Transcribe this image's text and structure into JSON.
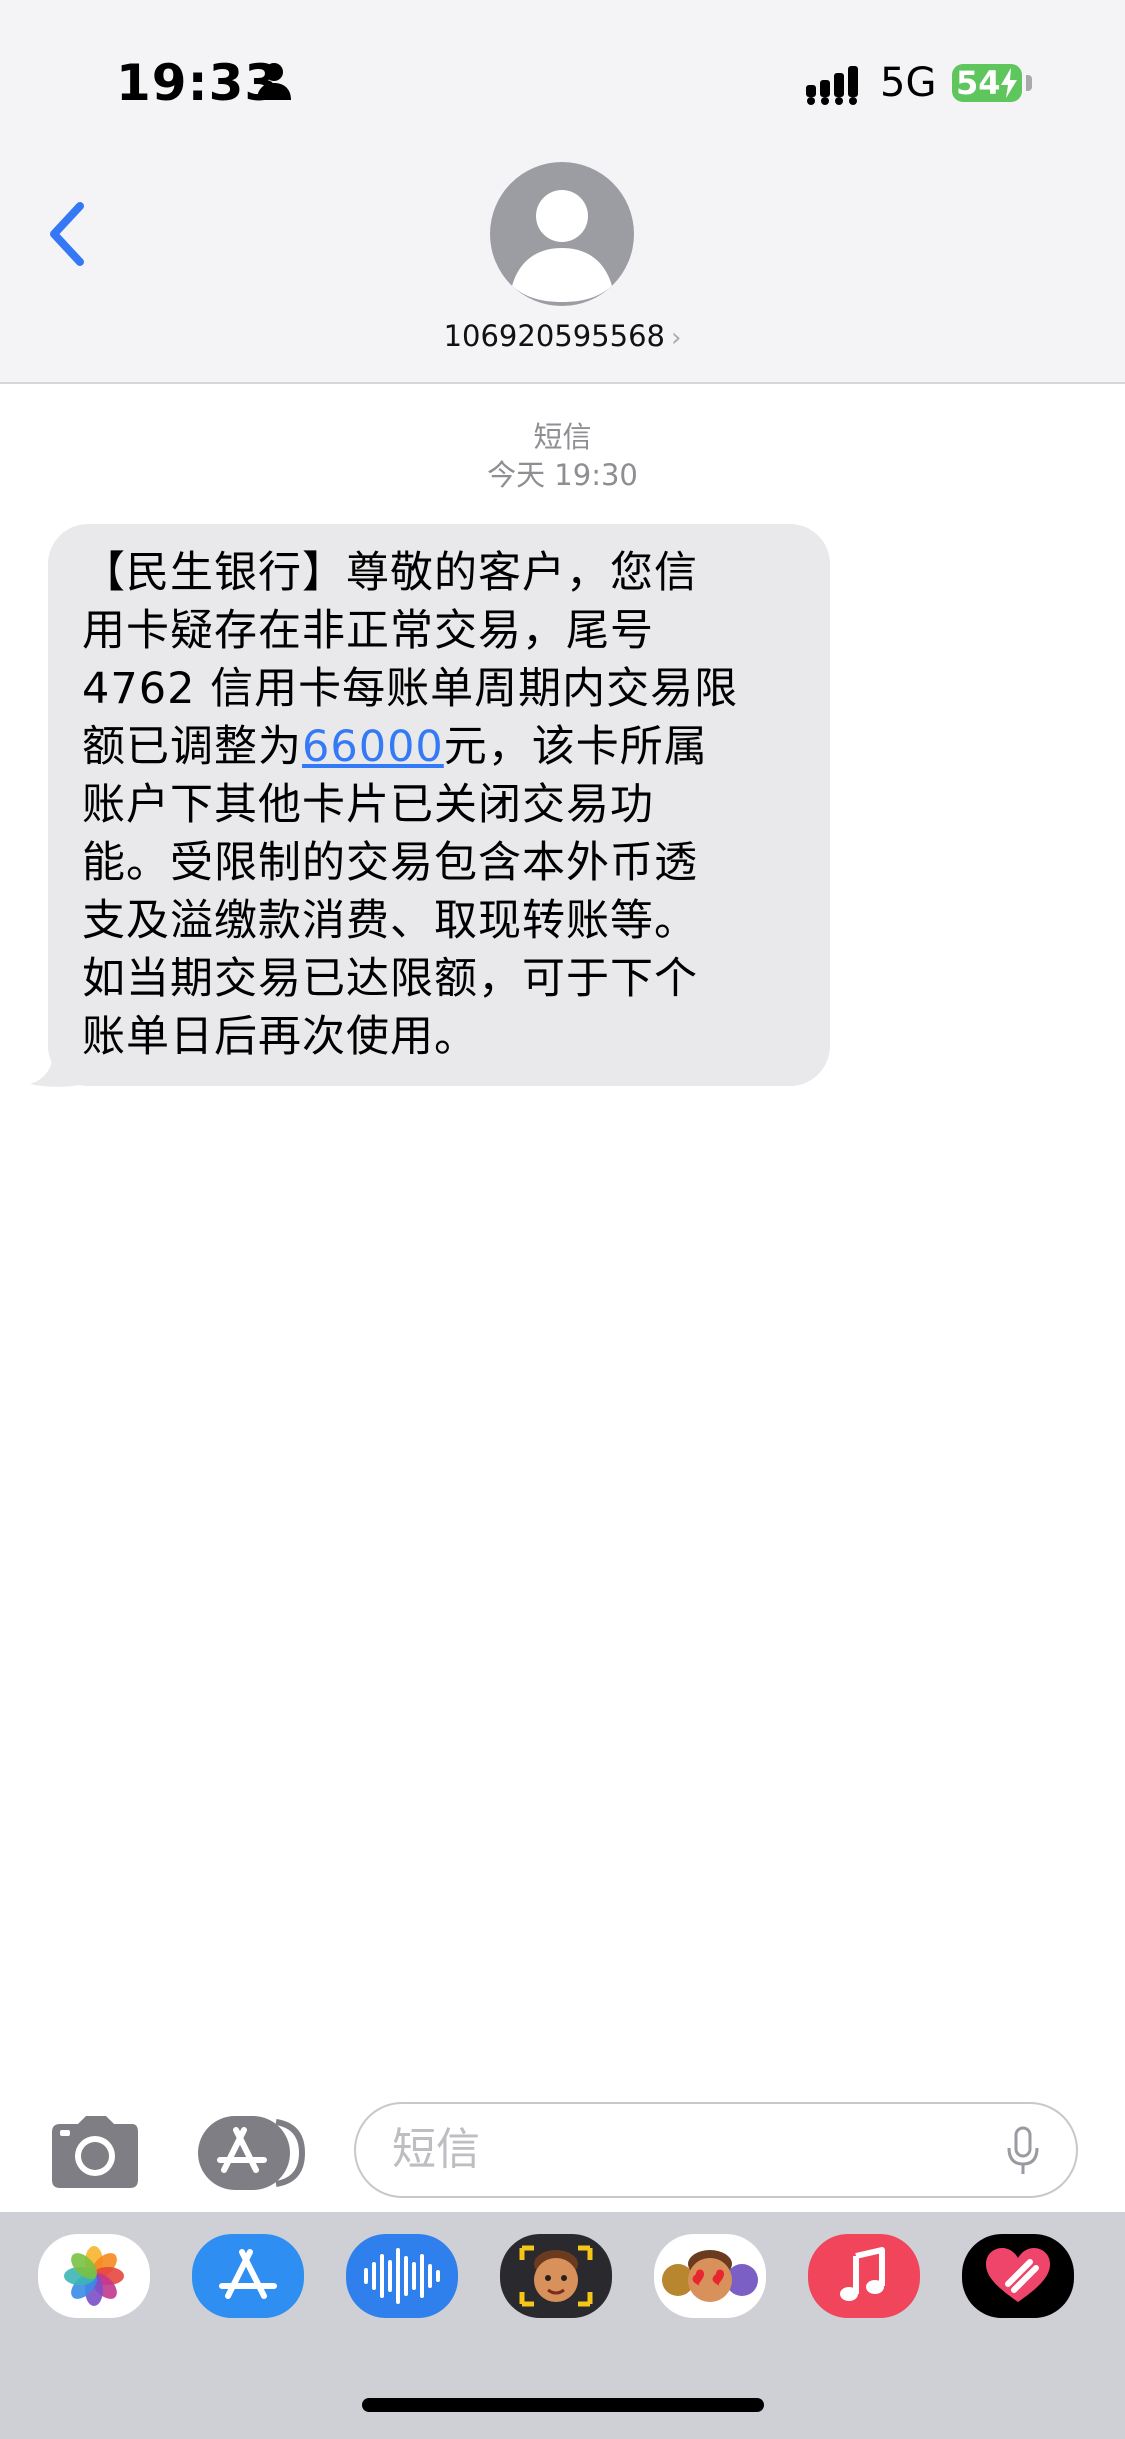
{
  "status_bar": {
    "time": "19:33",
    "network": "5G",
    "battery": "54"
  },
  "contact": {
    "number": "106920595568"
  },
  "thread": {
    "service": "短信",
    "timestamp": "今天 19:30"
  },
  "message": {
    "lines": [
      "【民生银行】尊敬的客户，您信",
      "用卡疑存在非正常交易，尾号",
      "4762 信用卡每账单周期内交易限"
    ],
    "line4_before": "额已调整为",
    "amount_link": "66000",
    "line4_after": "元，该卡所属",
    "lines_after": [
      "账户下其他卡片已关闭交易功",
      "能。受限制的交易包含本外币透",
      "支及溢缴款消费、取现转账等。",
      "如当期交易已达限额，可于下个",
      "账单日后再次使用。"
    ]
  },
  "composer": {
    "placeholder": "短信"
  },
  "drawer_apps": [
    "photos-icon",
    "app-store-icon",
    "audio-message-icon",
    "memoji-icon",
    "memoji-stickers-icon",
    "music-icon",
    "digital-touch-icon"
  ],
  "colors": {
    "accent": "#3478f6",
    "bubble": "#e9e9eb",
    "battery": "#5fc55d"
  }
}
